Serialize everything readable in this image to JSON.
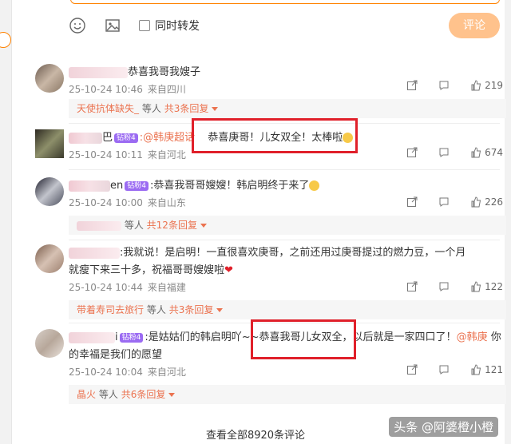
{
  "toolbar": {
    "repost_label": "同时转发",
    "comment_button": "评论"
  },
  "comments": [
    {
      "name_visible": "",
      "text": "恭喜我哥我嫂子",
      "time": "25-10-24 10:46",
      "location": "来自四川",
      "likes": "219",
      "replies": {
        "name": "天使抗体缺失_",
        "suffix": "等人",
        "more": "共3条回复"
      }
    },
    {
      "name_visible": "巴",
      "badge": "钻粉4",
      "mention": ":@韩庚超话",
      "text": "恭喜庚哥！儿女双全！太棒啦",
      "time": "25-10-24 10:11",
      "location": "来自河北",
      "likes": "674"
    },
    {
      "name_visible": "en",
      "badge": "钻粉4",
      "text": ":恭喜我哥哥嫂嫂！韩启明终于来了",
      "time": "25-10-24 10:00",
      "location": "来自山东",
      "likes": "226",
      "replies": {
        "name": "",
        "suffix": "等人",
        "more": "共12条回复"
      }
    },
    {
      "name_visible": "",
      "text_line1": ":我就说！是启明！一直很喜欢庚哥，之前还用过庚哥提过的燃力豆，一个月",
      "text_line2": "就瘦下来三十多，祝福哥哥嫂嫂啦",
      "time": "25-10-24 10:44",
      "location": "来自福建",
      "likes": "122",
      "replies": {
        "name": "带着寿司去旅行",
        "suffix": "等人",
        "more": "共3条回复"
      }
    },
    {
      "name_visible": "i",
      "badge": "钻粉4",
      "text_prefix": ":是姑姑们的韩启明吖~~",
      "text_highlight": "恭喜我哥儿女双全",
      "text_suffix": "，以后就是一家四口了！",
      "mention": "@韩庚",
      "text_tail": "你",
      "text_line2": "的幸福是我们的愿望",
      "time": "25-10-24 10:04",
      "location": "来自河北",
      "likes": "121",
      "replies": {
        "name": "晶火",
        "suffix": "等人",
        "more": "共6条回复"
      }
    }
  ],
  "view_all": "查看全部8920条评论",
  "watermark": "头条 @阿婆橙小橙"
}
